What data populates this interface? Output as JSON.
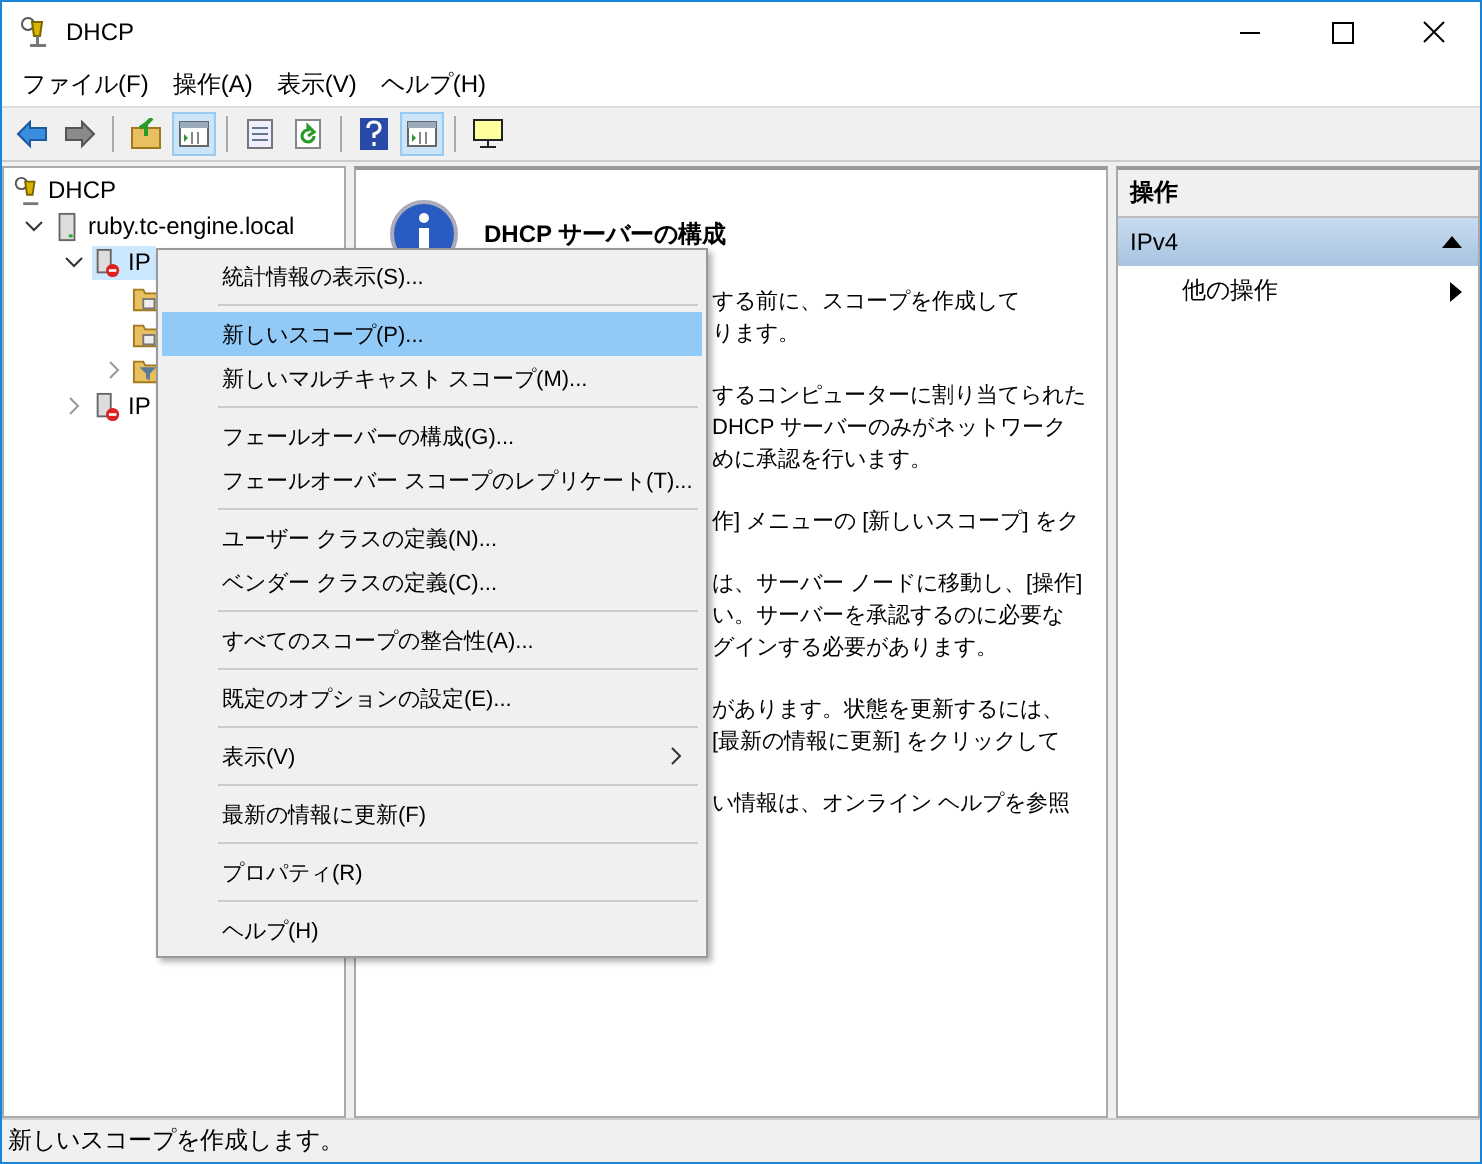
{
  "window": {
    "title": "DHCP"
  },
  "menu_bar": [
    "ファイル(F)",
    "操作(A)",
    "表示(V)",
    "ヘルプ(H)"
  ],
  "toolbar": [
    {
      "kind": "back",
      "on": false
    },
    {
      "kind": "forward",
      "on": false
    },
    {
      "kind": "sep"
    },
    {
      "kind": "up",
      "on": false
    },
    {
      "kind": "pane",
      "on": true
    },
    {
      "kind": "sep"
    },
    {
      "kind": "list",
      "on": false
    },
    {
      "kind": "refresh",
      "on": false
    },
    {
      "kind": "sep"
    },
    {
      "kind": "help",
      "on": false
    },
    {
      "kind": "pane",
      "on": true
    },
    {
      "kind": "sep"
    },
    {
      "kind": "monitor",
      "on": false
    }
  ],
  "tree": [
    {
      "label": "DHCP",
      "kind": "dhcp",
      "selected": false,
      "children": [
        {
          "label": "ruby.tc-engine.local",
          "kind": "server",
          "expanded": true,
          "selected": false,
          "children": [
            {
              "label": "IP",
              "kind": "ip",
              "expanded": true,
              "selected": true,
              "children": [
                {
                  "kind": "folder",
                  "selected": false
                },
                {
                  "kind": "folder",
                  "selected": false
                },
                {
                  "kind": "filter",
                  "expanded": false,
                  "selected": false
                }
              ]
            },
            {
              "label": "IP",
              "kind": "ip",
              "expanded": false,
              "selected": false
            }
          ]
        }
      ]
    }
  ],
  "content": {
    "title": "DHCP サーバーの構成",
    "paragraphs": [
      [
        "する前に、スコープを作成して",
        "ります。"
      ],
      [
        "するコンピューターに割り当てられた",
        "DHCP サーバーのみがネットワーク",
        "めに承認を行います。"
      ],
      [
        "作] メニューの [新しいスコープ] をク"
      ],
      [
        "は、サーバー ノードに移動し、[操作]",
        "い。サーバーを承認するのに必要な",
        "グインする必要があります。"
      ],
      [
        "があります。状態を更新するには、",
        "[最新の情報に更新] をクリックして"
      ],
      [
        "い情報は、オンライン ヘルプを参照"
      ]
    ]
  },
  "context_menu": [
    {
      "kind": "item",
      "label": "統計情報の表示(S)...",
      "selected": false
    },
    {
      "kind": "sep"
    },
    {
      "kind": "item",
      "label": "新しいスコープ(P)...",
      "selected": true
    },
    {
      "kind": "item",
      "label": "新しいマルチキャスト スコープ(M)...",
      "selected": false
    },
    {
      "kind": "sep"
    },
    {
      "kind": "item",
      "label": "フェールオーバーの構成(G)...",
      "selected": false
    },
    {
      "kind": "item",
      "label": "フェールオーバー スコープのレプリケート(T)...",
      "selected": false
    },
    {
      "kind": "sep"
    },
    {
      "kind": "item",
      "label": "ユーザー クラスの定義(N)...",
      "selected": false
    },
    {
      "kind": "item",
      "label": "ベンダー クラスの定義(C)...",
      "selected": false
    },
    {
      "kind": "sep"
    },
    {
      "kind": "item",
      "label": "すべてのスコープの整合性(A)...",
      "selected": false
    },
    {
      "kind": "sep"
    },
    {
      "kind": "item",
      "label": "既定のオプションの設定(E)...",
      "selected": false
    },
    {
      "kind": "sep"
    },
    {
      "kind": "submenu",
      "label": "表示(V)",
      "selected": false
    },
    {
      "kind": "sep"
    },
    {
      "kind": "item",
      "label": "最新の情報に更新(F)",
      "selected": false
    },
    {
      "kind": "sep"
    },
    {
      "kind": "item",
      "label": "プロパティ(R)",
      "selected": false
    },
    {
      "kind": "sep"
    },
    {
      "kind": "item",
      "label": "ヘルプ(H)",
      "selected": false
    }
  ],
  "actions": {
    "header": "操作",
    "section": {
      "label": "IPv4",
      "expanded": true
    },
    "items": [
      {
        "label": "他の操作"
      }
    ]
  },
  "status_bar": "新しいスコープを作成します。"
}
